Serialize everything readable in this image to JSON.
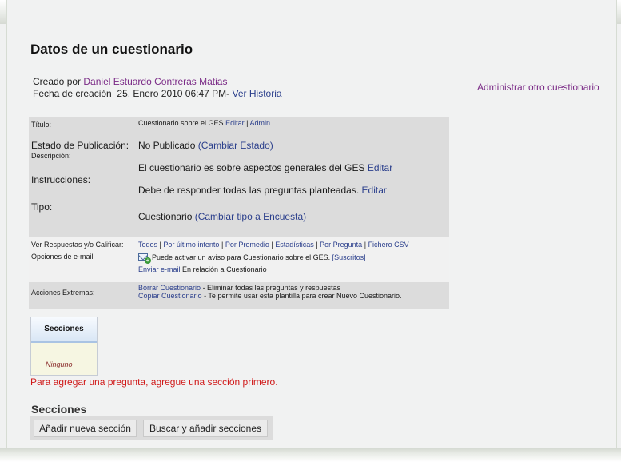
{
  "title": "Datos de un cuestionario",
  "meta": {
    "created_by_label": "Creado por",
    "author": "Daniel Estuardo Contreras Matias",
    "date_label": "Fecha de creación",
    "date_value": "25, Enero 2010 06:47 PM-",
    "history_link": "Ver Historia"
  },
  "admin_other_link": "Administrar otro cuestionario",
  "info": {
    "titulo_label": "Título:",
    "titulo_value": "Cuestionario sobre el GES",
    "editar": "Editar",
    "sep": "|",
    "admin": "Admin",
    "estado_label": "Estado de Publicación:",
    "estado_value": "No Publicado",
    "cambiar_estado": "(Cambiar Estado)",
    "descripcion_label": "Descripción:",
    "descripcion_value": "El cuestionario es sobre aspectos generales del GES",
    "instrucciones_label": "Instrucciones:",
    "instrucciones_value": "Debe de responder todas las preguntas planteadas.",
    "tipo_label": "Tipo:",
    "tipo_value": "Cuestionario",
    "cambiar_tipo": "(Cambiar tipo a Encuesta)",
    "respuestas_label": "Ver Respuestas y/o Calificar:",
    "respuestas_links": [
      "Todos",
      "Por último intento",
      "Por Promedio",
      "Estadísticas",
      "Por Pregunta",
      "Fichero CSV"
    ],
    "email_label": "Opciones de e-mail",
    "aviso_text": "Puede activar un aviso para Cuestionario sobre el GES.",
    "suscritos": "[Suscritos]",
    "enviar_email": "Enviar e-mail",
    "enviar_relacion": "En relación a Cuestionario",
    "acciones_label": "Acciones Extremas:",
    "borrar_link": "Borrar Cuestionario",
    "borrar_desc": "- Eliminar todas las preguntas y respuestas",
    "copiar_link": "Copiar Cuestionario",
    "copiar_desc": "- Te permite usar esta plantilla para crear Nuevo Cuestionario."
  },
  "sections_box": {
    "header": "Secciones",
    "empty": "Ninguno"
  },
  "warning": "Para agregar una pregunta, agregue una sección primero.",
  "sections_label": "Secciones",
  "buttons": {
    "add_section": "Añadir nueva sección",
    "search_add": "Buscar y añadir secciones"
  }
}
